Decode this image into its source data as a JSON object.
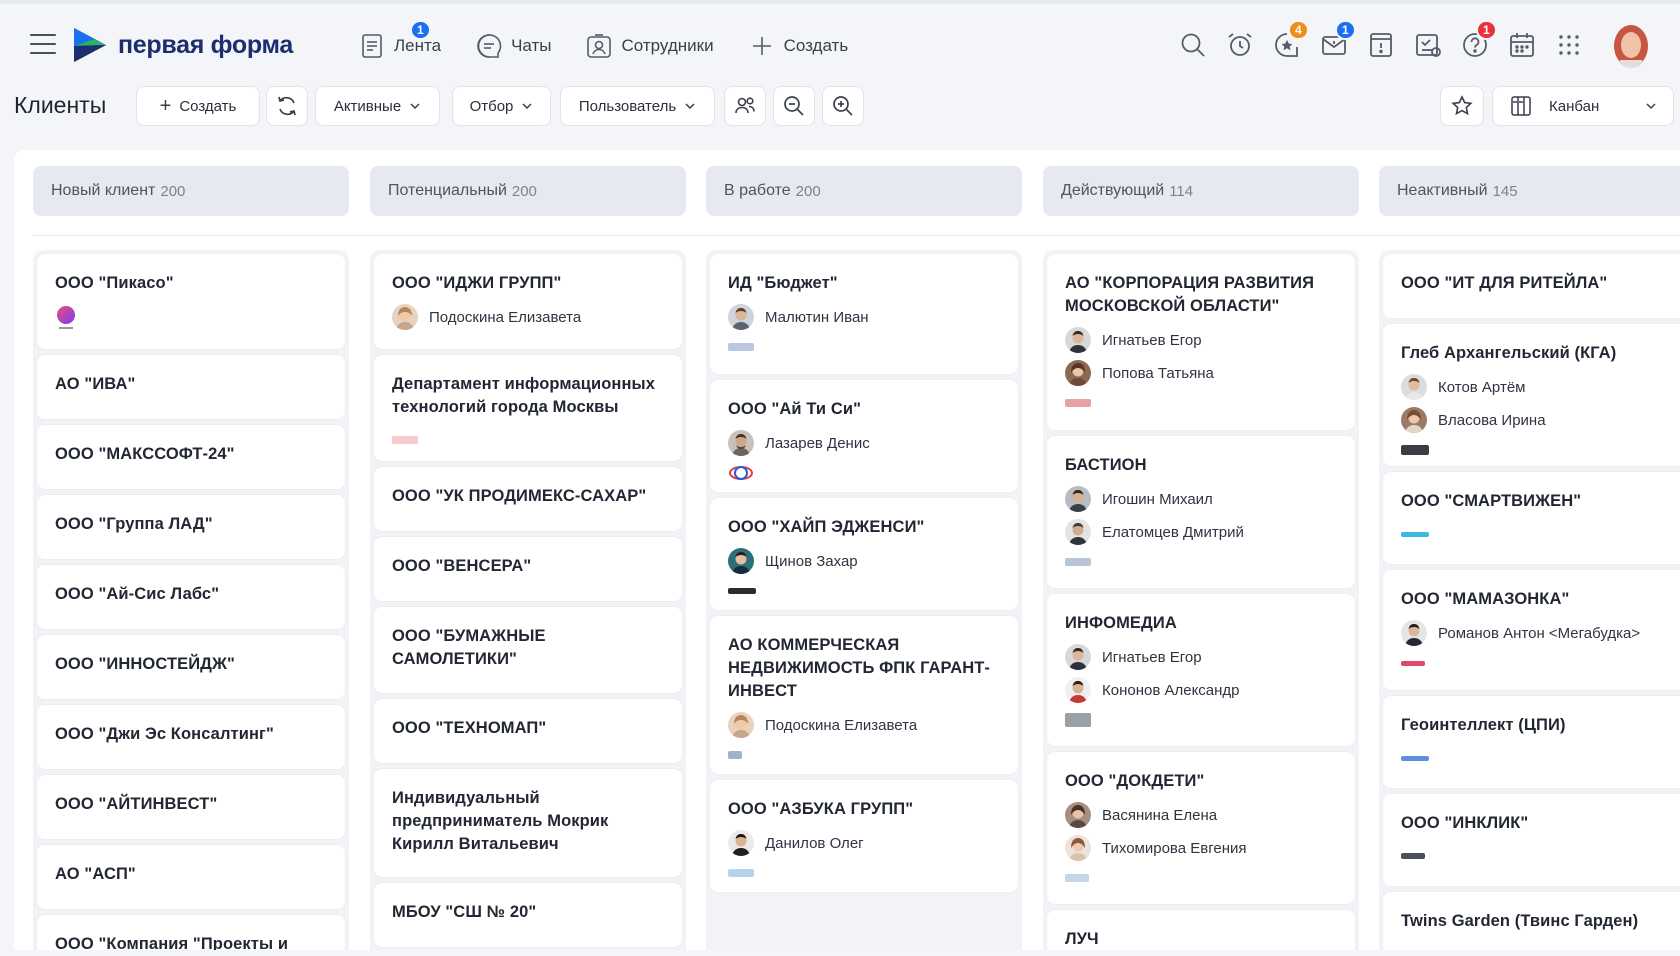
{
  "app": {
    "logo_text": "первая форма",
    "nav": [
      {
        "label": "Лента",
        "icon": "feed-icon",
        "badge": "1"
      },
      {
        "label": "Чаты",
        "icon": "chat-icon",
        "badge": ""
      },
      {
        "label": "Сотрудники",
        "icon": "employees-icon",
        "badge": ""
      },
      {
        "label": "Создать",
        "icon": "plus-icon",
        "badge": ""
      }
    ],
    "right_icons": [
      {
        "icon": "search-icon",
        "badge": ""
      },
      {
        "icon": "alarm-clock-icon",
        "badge": ""
      },
      {
        "icon": "star-bubble-icon",
        "badge": "4",
        "badge_color": "orange"
      },
      {
        "icon": "mail-icon",
        "badge": "1",
        "badge_color": "blue"
      },
      {
        "icon": "tasks-alert-icon",
        "badge": ""
      },
      {
        "icon": "document-icon",
        "badge": ""
      },
      {
        "icon": "help-icon",
        "badge": "1",
        "badge_color": "red"
      },
      {
        "icon": "calendar-icon",
        "badge": ""
      },
      {
        "icon": "apps-grid-icon",
        "badge": ""
      }
    ]
  },
  "toolbar": {
    "title": "Клиенты",
    "create_label": "Создать",
    "filter_active": "Активные",
    "filter_selection": "Отбор",
    "filter_user": "Пользователь",
    "view_label": "Канбан"
  },
  "columns": [
    {
      "name": "Новый клиент",
      "count": "200"
    },
    {
      "name": "Потенциальный",
      "count": "200"
    },
    {
      "name": "В работе",
      "count": "200"
    },
    {
      "name": "Действующий",
      "count": "114"
    },
    {
      "name": "Неактивный",
      "count": "145"
    }
  ],
  "cards": {
    "c0": [
      {
        "title": "ООО \"Пикасо\""
      },
      {
        "title": "АО \"ИВА\""
      },
      {
        "title": "ООО \"МАКССОФТ-24\""
      },
      {
        "title": "ООО \"Группа ЛАД\""
      },
      {
        "title": "ООО \"Ай-Сис Лабс\""
      },
      {
        "title": "ООО \"ИННОСТЕЙДЖ\""
      },
      {
        "title": "ООО \"Джи Эс Консалтинг\""
      },
      {
        "title": "ООО \"АЙТИНВЕСТ\""
      },
      {
        "title": "АО \"АСП\""
      },
      {
        "title": "ООО \"Компания \"Проекты и"
      }
    ],
    "c1": [
      {
        "title": "ООО \"ИДЖИ ГРУПП\"",
        "p1": "Подоскина Елизавета"
      },
      {
        "title": "Департамент информационных технологий города Москвы"
      },
      {
        "title": "ООО \"УК ПРОДИМЕКС-САХАР\""
      },
      {
        "title": "ООО \"ВЕНСЕРА\""
      },
      {
        "title": "ООО \"БУМАЖНЫЕ САМОЛЕТИКИ\""
      },
      {
        "title": "ООО \"ТЕХНОМАП\""
      },
      {
        "title": "Индивидуальный предприниматель Мокрик Кирилл Витальевич"
      },
      {
        "title": "МБОУ \"СШ № 20\""
      }
    ],
    "c2": [
      {
        "title": "ИД \"Бюджет\"",
        "p1": "Малютин Иван"
      },
      {
        "title": "ООО \"Ай Ти Си\"",
        "p1": "Лазарев Денис"
      },
      {
        "title": "ООО \"ХАЙП ЭДЖЕНСИ\"",
        "p1": "Щинов Захар"
      },
      {
        "title": "АО КОММЕРЧЕСКАЯ НЕДВИЖИМОСТЬ ФПК ГАРАНТ-ИНВЕСТ",
        "p1": "Подоскина Елизавета"
      },
      {
        "title": "ООО \"АЗБУКА ГРУПП\"",
        "p1": "Данилов Олег"
      }
    ],
    "c3": [
      {
        "title": "АО \"КОРПОРАЦИЯ РАЗВИТИЯ МОСКОВСКОЙ ОБЛАСТИ\"",
        "p1": "Игнатьев Егор",
        "p2": "Попова Татьяна"
      },
      {
        "title": "БАСТИОН",
        "p1": "Игошин Михаил",
        "p2": "Елатомцев Дмитрий"
      },
      {
        "title": "ИНФОМЕДИА",
        "p1": "Игнатьев Егор",
        "p2": "Кононов Александр"
      },
      {
        "title": "ООО \"ДОКДЕТИ\"",
        "p1": "Васянина Елена",
        "p2": "Тихомирова Евгения"
      },
      {
        "title": "ЛУЧ"
      }
    ],
    "c4": [
      {
        "title": "ООО \"ИТ ДЛЯ РИТЕЙЛА\""
      },
      {
        "title": "Глеб Архангельский (КГА)",
        "p1": "Котов Артём",
        "p2": "Власова Ирина"
      },
      {
        "title": "ООО \"СМАРТВИЖЕН\""
      },
      {
        "title": "ООО \"МАМАЗОНКА\"",
        "p1": "Романов Антон <Мегабудка>"
      },
      {
        "title": "Геоинтеллект (ЦПИ)"
      },
      {
        "title": "ООО \"ИНКЛИК\""
      },
      {
        "title": "Twins Garden (Твинс Гарден)"
      }
    ]
  },
  "colors": {
    "accent": "#1b6ff0",
    "brand_dark": "#1c2e6e",
    "badge_orange": "#f08c1a",
    "badge_red": "#e8323c"
  }
}
